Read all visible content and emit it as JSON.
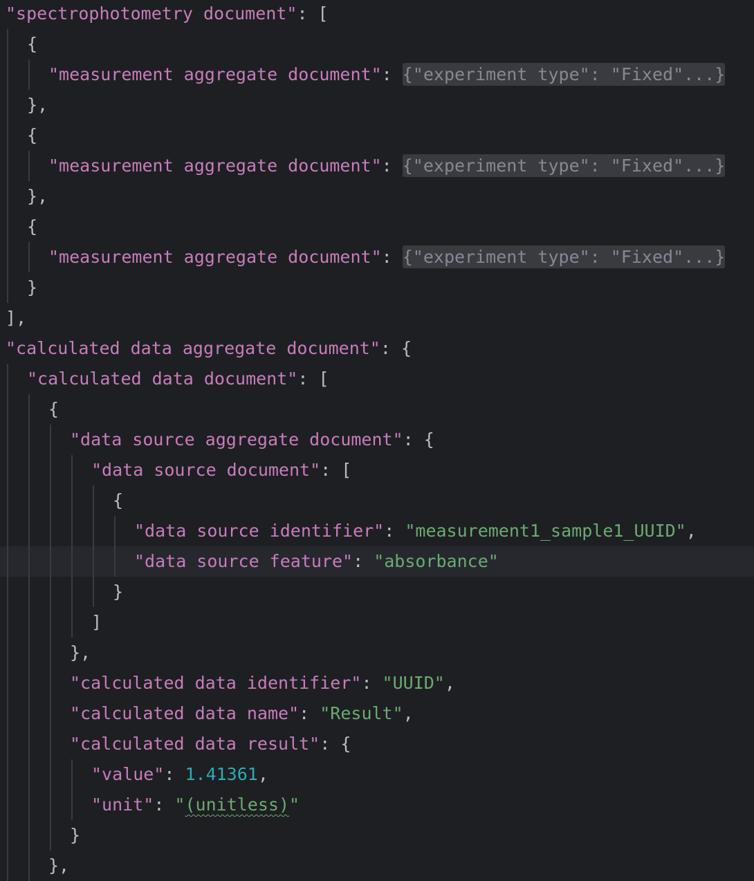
{
  "editor": {
    "lines": [
      {
        "indent": 0,
        "tokens": [
          {
            "t": "key",
            "v": "\"spectrophotometry document\""
          },
          {
            "t": "pun",
            "v": ": ["
          }
        ]
      },
      {
        "indent": 1,
        "tokens": [
          {
            "t": "pun",
            "v": "{"
          }
        ]
      },
      {
        "indent": 2,
        "tokens": [
          {
            "t": "key",
            "v": "\"measurement aggregate document\""
          },
          {
            "t": "pun",
            "v": ": "
          },
          {
            "t": "fold",
            "v": "{\"experiment type\": \"Fixed\"...}"
          }
        ]
      },
      {
        "indent": 1,
        "tokens": [
          {
            "t": "pun",
            "v": "},"
          }
        ]
      },
      {
        "indent": 1,
        "tokens": [
          {
            "t": "pun",
            "v": "{"
          }
        ]
      },
      {
        "indent": 2,
        "tokens": [
          {
            "t": "key",
            "v": "\"measurement aggregate document\""
          },
          {
            "t": "pun",
            "v": ": "
          },
          {
            "t": "fold",
            "v": "{\"experiment type\": \"Fixed\"...}"
          }
        ]
      },
      {
        "indent": 1,
        "tokens": [
          {
            "t": "pun",
            "v": "},"
          }
        ]
      },
      {
        "indent": 1,
        "tokens": [
          {
            "t": "pun",
            "v": "{"
          }
        ]
      },
      {
        "indent": 2,
        "tokens": [
          {
            "t": "key",
            "v": "\"measurement aggregate document\""
          },
          {
            "t": "pun",
            "v": ": "
          },
          {
            "t": "fold",
            "v": "{\"experiment type\": \"Fixed\"...}"
          }
        ]
      },
      {
        "indent": 1,
        "tokens": [
          {
            "t": "pun",
            "v": "}"
          }
        ]
      },
      {
        "indent": 0,
        "tokens": [
          {
            "t": "pun",
            "v": "],"
          }
        ]
      },
      {
        "indent": 0,
        "tokens": [
          {
            "t": "key",
            "v": "\"calculated data aggregate document\""
          },
          {
            "t": "pun",
            "v": ": {"
          }
        ]
      },
      {
        "indent": 1,
        "tokens": [
          {
            "t": "key",
            "v": "\"calculated data document\""
          },
          {
            "t": "pun",
            "v": ": ["
          }
        ]
      },
      {
        "indent": 2,
        "tokens": [
          {
            "t": "pun",
            "v": "{"
          }
        ]
      },
      {
        "indent": 3,
        "tokens": [
          {
            "t": "key",
            "v": "\"data source aggregate document\""
          },
          {
            "t": "pun",
            "v": ": {"
          }
        ]
      },
      {
        "indent": 4,
        "tokens": [
          {
            "t": "key",
            "v": "\"data source document\""
          },
          {
            "t": "pun",
            "v": ": ["
          }
        ]
      },
      {
        "indent": 5,
        "tokens": [
          {
            "t": "pun",
            "v": "{"
          }
        ]
      },
      {
        "indent": 6,
        "tokens": [
          {
            "t": "key",
            "v": "\"data source identifier\""
          },
          {
            "t": "pun",
            "v": ": "
          },
          {
            "t": "str",
            "v": "\"measurement1_sample1_UUID\""
          },
          {
            "t": "pun",
            "v": ","
          }
        ]
      },
      {
        "indent": 6,
        "current": true,
        "tokens": [
          {
            "t": "key",
            "v": "\"data source feature\""
          },
          {
            "t": "pun",
            "v": ": "
          },
          {
            "t": "str",
            "v": "\"absorbance\""
          }
        ]
      },
      {
        "indent": 5,
        "tokens": [
          {
            "t": "pun",
            "v": "}"
          }
        ]
      },
      {
        "indent": 4,
        "tokens": [
          {
            "t": "pun",
            "v": "]"
          }
        ]
      },
      {
        "indent": 3,
        "tokens": [
          {
            "t": "pun",
            "v": "},"
          }
        ]
      },
      {
        "indent": 3,
        "tokens": [
          {
            "t": "key",
            "v": "\"calculated data identifier\""
          },
          {
            "t": "pun",
            "v": ": "
          },
          {
            "t": "str",
            "v": "\"UUID\""
          },
          {
            "t": "pun",
            "v": ","
          }
        ]
      },
      {
        "indent": 3,
        "tokens": [
          {
            "t": "key",
            "v": "\"calculated data name\""
          },
          {
            "t": "pun",
            "v": ": "
          },
          {
            "t": "str",
            "v": "\"Result\""
          },
          {
            "t": "pun",
            "v": ","
          }
        ]
      },
      {
        "indent": 3,
        "tokens": [
          {
            "t": "key",
            "v": "\"calculated data result\""
          },
          {
            "t": "pun",
            "v": ": {"
          }
        ]
      },
      {
        "indent": 4,
        "tokens": [
          {
            "t": "key",
            "v": "\"value\""
          },
          {
            "t": "pun",
            "v": ": "
          },
          {
            "t": "num",
            "v": "1.41361"
          },
          {
            "t": "pun",
            "v": ","
          }
        ]
      },
      {
        "indent": 4,
        "tokens": [
          {
            "t": "key",
            "v": "\"unit\""
          },
          {
            "t": "pun",
            "v": ": "
          },
          {
            "t": "str",
            "v": "\""
          },
          {
            "t": "str-squiggle",
            "v": "(unitless)"
          },
          {
            "t": "str",
            "v": "\""
          }
        ]
      },
      {
        "indent": 3,
        "tokens": [
          {
            "t": "pun",
            "v": "}"
          }
        ]
      },
      {
        "indent": 2,
        "tokens": [
          {
            "t": "pun",
            "v": "},"
          }
        ]
      }
    ]
  },
  "colors": {
    "background": "#1e1f22",
    "current_line": "#26282e",
    "key": "#c77dbb",
    "string": "#6aab73",
    "number": "#2aacb8",
    "punctuation": "#bcbec4",
    "fold_text": "#868991",
    "fold_background": "#393b40",
    "indent_guide": "#393b40"
  }
}
